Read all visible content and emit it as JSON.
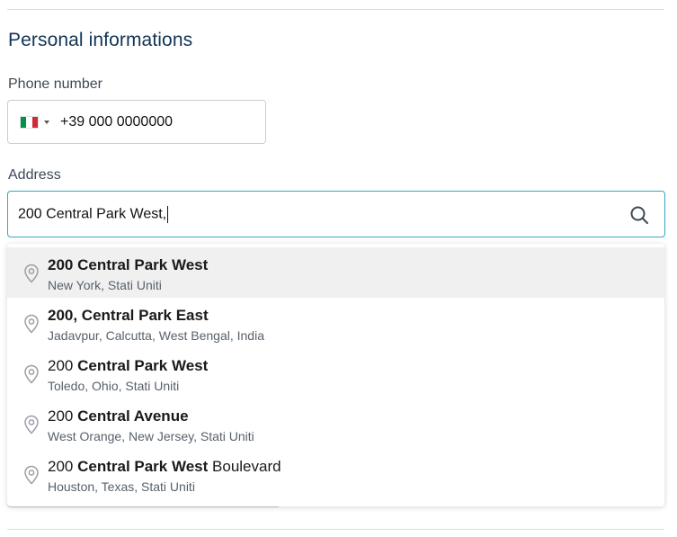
{
  "section_title": "Personal informations",
  "phone": {
    "label": "Phone number",
    "country_flag": "italy-flag",
    "value": "+39 000 0000000"
  },
  "address": {
    "label": "Address",
    "value": "200 Central Park West,",
    "search_icon": "search-icon",
    "focus_color": "#34a7c1"
  },
  "suggestions": [
    {
      "parts": [
        {
          "text": "200 Central Park West",
          "bold": true
        }
      ],
      "secondary": "New York, Stati Uniti",
      "highlighted": true
    },
    {
      "parts": [
        {
          "text": "200, Central Park East",
          "bold": true
        }
      ],
      "secondary": "Jadavpur, Calcutta, West Bengal, India",
      "highlighted": false
    },
    {
      "parts": [
        {
          "text": "200 ",
          "bold": false
        },
        {
          "text": "Central Park West",
          "bold": true
        }
      ],
      "secondary": "Toledo, Ohio, Stati Uniti",
      "highlighted": false
    },
    {
      "parts": [
        {
          "text": "200 ",
          "bold": false
        },
        {
          "text": "Central Avenue",
          "bold": true
        }
      ],
      "secondary": "West Orange, New Jersey, Stati Uniti",
      "highlighted": false
    },
    {
      "parts": [
        {
          "text": "200 ",
          "bold": false
        },
        {
          "text": "Central Park West",
          "bold": true
        },
        {
          "text": " Boulevard",
          "bold": false
        }
      ],
      "secondary": "Houston, Texas, Stati Uniti",
      "highlighted": false
    }
  ],
  "colors": {
    "title": "#123456",
    "highlight_row": "#f0f0f0",
    "pin_icon": "#9aa0a6"
  }
}
